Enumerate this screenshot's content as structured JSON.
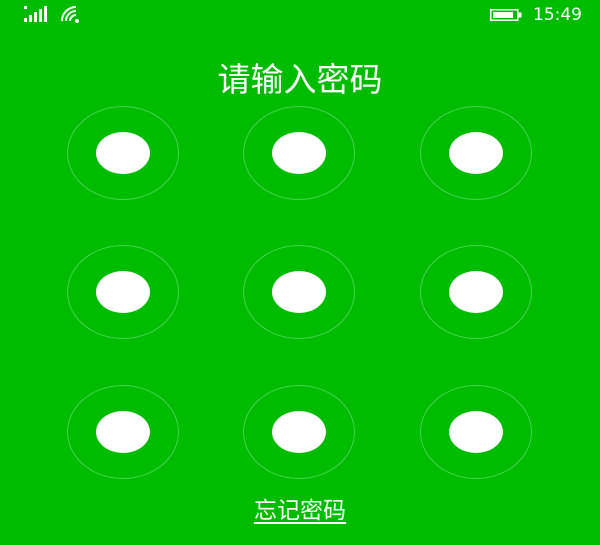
{
  "status_bar": {
    "signal_icon": "cellular-signal-icon",
    "wifi_icon": "wifi-icon",
    "battery_icon": "battery-icon",
    "time": "15:49"
  },
  "title": "请输入密码",
  "pattern": {
    "rows": 3,
    "cols": 3,
    "nodes": [
      1,
      2,
      3,
      4,
      5,
      6,
      7,
      8,
      9
    ]
  },
  "forgot_password_link": "忘记密码",
  "colors": {
    "background": "#00bc00",
    "foreground": "#ffffff",
    "ring": "#7fe296"
  }
}
